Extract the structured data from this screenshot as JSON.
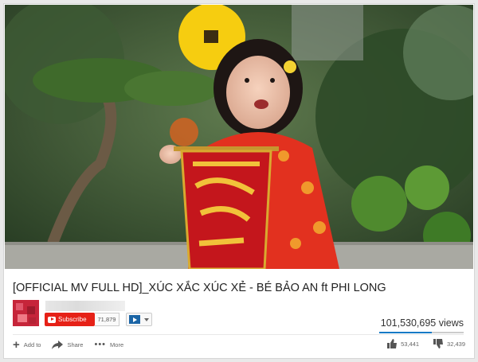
{
  "video": {
    "title": "[OFFICIAL MV FULL HD]_XÚC XẮC XÚC XẺ - BÉ BẢO AN ft PHI LONG"
  },
  "channel": {
    "subscribe_label": "Subscribe",
    "subscriber_count": "71,879"
  },
  "stats": {
    "views": "101,530,695 views",
    "likes": "53,441",
    "dislikes": "32,439",
    "like_ratio": 0.62
  },
  "actions": {
    "add_to": "Add to",
    "share": "Share",
    "more": "More"
  },
  "colors": {
    "subscribe": "#e62117",
    "like_bar": "#167ac6"
  }
}
